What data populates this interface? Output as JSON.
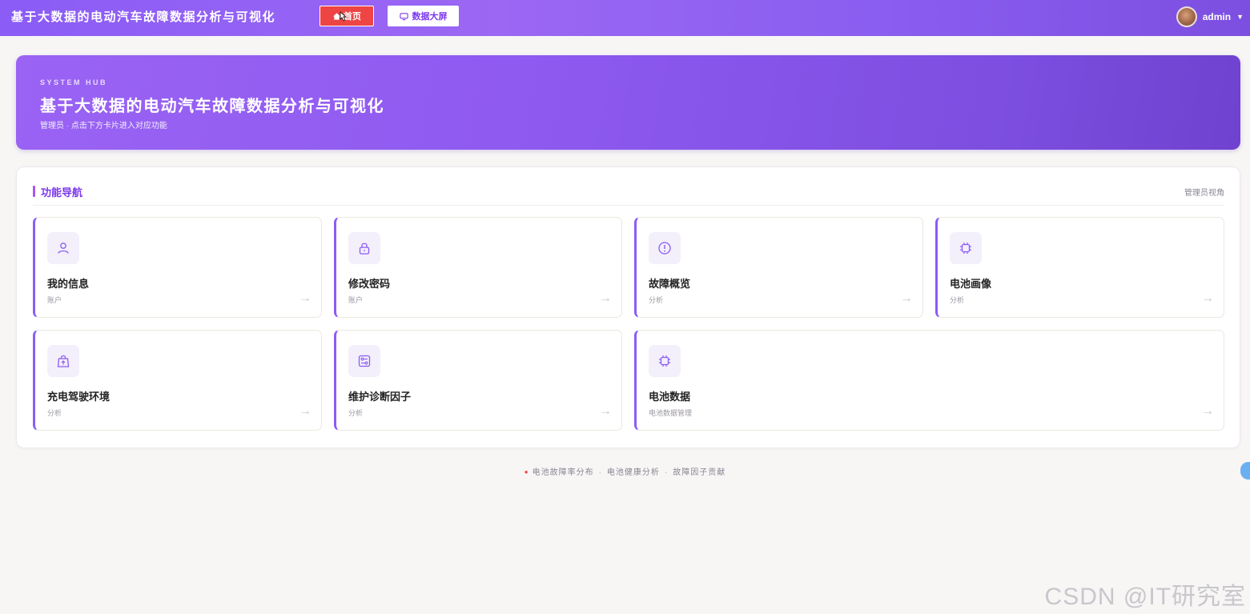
{
  "header": {
    "brand": "基于大数据的电动汽车故障数据分析与可视化",
    "nav": [
      {
        "label": "首页",
        "icon": "home-icon",
        "active": true
      },
      {
        "label": "数据大屏",
        "icon": "monitor-icon",
        "active": false
      }
    ],
    "user": {
      "name": "admin"
    }
  },
  "hero": {
    "kicker": "SYSTEM HUB",
    "title": "基于大数据的电动汽车故障数据分析与可视化",
    "subtitle": "管理员 · 点击下方卡片进入对应功能"
  },
  "panel": {
    "title": "功能导航",
    "meta": "管理员视角",
    "cards": [
      {
        "title": "我的信息",
        "sub": "账户",
        "icon": "user-icon"
      },
      {
        "title": "修改密码",
        "sub": "账户",
        "icon": "lock-icon"
      },
      {
        "title": "故障概览",
        "sub": "分析",
        "icon": "alert-circle-icon"
      },
      {
        "title": "电池画像",
        "sub": "分析",
        "icon": "chip-icon"
      },
      {
        "title": "充电驾驶环境",
        "sub": "分析",
        "icon": "shopping-bag-icon"
      },
      {
        "title": "维护诊断因子",
        "sub": "分析",
        "icon": "settings-panel-icon"
      },
      {
        "title": "电池数据",
        "sub": "电池数据管理",
        "icon": "chip-icon"
      }
    ]
  },
  "footer": {
    "tags": [
      "电池故障率分布",
      "电池健康分析",
      "故障因子贡献"
    ]
  },
  "watermark": "CSDN @IT研究室",
  "colors": {
    "accent": "#8b5cf6",
    "active_nav": "#ef4444",
    "card_border": "#8b5cf6"
  }
}
